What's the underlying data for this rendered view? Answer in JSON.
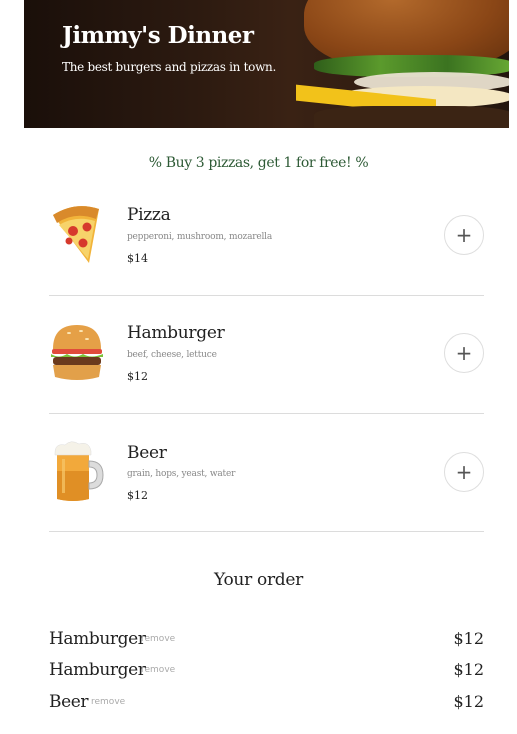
{
  "header": {
    "title": "Jimmy's Dinner",
    "tagline": "The best burgers and pizzas in town."
  },
  "promo": "% Buy 3 pizzas, get 1 for free! %",
  "menu": {
    "items": [
      {
        "icon": "pizza-icon",
        "name": "Pizza",
        "description": "pepperoni, mushroom, mozarella",
        "price": "$14",
        "add_label": "+"
      },
      {
        "icon": "hamburger-icon",
        "name": "Hamburger",
        "description": "beef, cheese, lettuce",
        "price": "$12",
        "add_label": "+"
      },
      {
        "icon": "beer-icon",
        "name": "Beer",
        "description": "grain, hops, yeast, water",
        "price": "$12",
        "add_label": "+"
      }
    ]
  },
  "order": {
    "title": "Your order",
    "remove_label": "remove",
    "items": [
      {
        "name": "Hamburger",
        "price": "$12"
      },
      {
        "name": "Hamburger",
        "price": "$12"
      },
      {
        "name": "Beer",
        "price": "$12"
      }
    ]
  }
}
